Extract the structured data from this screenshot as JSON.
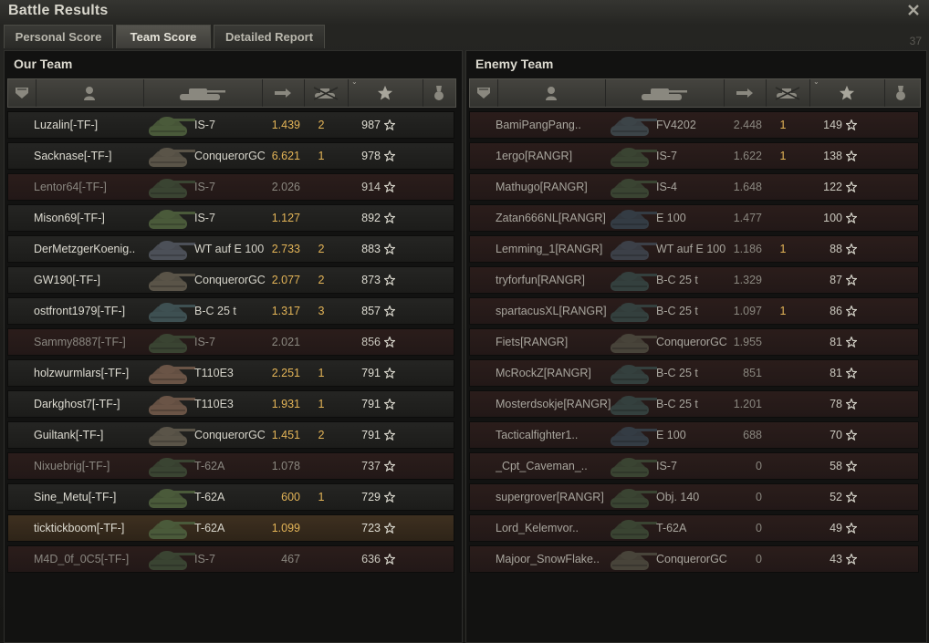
{
  "window": {
    "title": "Battle Results",
    "tab_counter": "37"
  },
  "tabs": [
    {
      "label": "Personal Score"
    },
    {
      "label": "Team Score"
    },
    {
      "label": "Detailed Report"
    }
  ],
  "active_tab": 1,
  "columns": [
    "rank-icon",
    "player-icon",
    "tank-icon",
    "damage-icon",
    "kills-icon",
    "xp-star-icon",
    "medal-icon"
  ],
  "sorted_column": "xp",
  "our_team": {
    "title": "Our Team",
    "rows": [
      {
        "player": "Luzalin[-TF-]",
        "tank": "IS-7",
        "damage": "1.439",
        "kills": "2",
        "xp": "987",
        "state": "alive",
        "tank_color": "#4a5a3a"
      },
      {
        "player": "Sacknase[-TF-]",
        "tank": "ConquerorGC",
        "damage": "6.621",
        "kills": "1",
        "xp": "978",
        "state": "alive",
        "tank_color": "#5a5448"
      },
      {
        "player": "Lentor64[-TF-]",
        "tank": "IS-7",
        "damage": "2.026",
        "kills": "",
        "xp": "914",
        "state": "dead",
        "tank_color": "#3a4432"
      },
      {
        "player": "Mison69[-TF-]",
        "tank": "IS-7",
        "damage": "1.127",
        "kills": "",
        "xp": "892",
        "state": "alive",
        "tank_color": "#4a5a3a"
      },
      {
        "player": "DerMetzgerKoenig..",
        "tank": "WT auf E 100",
        "damage": "2.733",
        "kills": "2",
        "xp": "883",
        "state": "alive",
        "tank_color": "#4c5058"
      },
      {
        "player": "GW190[-TF-]",
        "tank": "ConquerorGC",
        "damage": "2.077",
        "kills": "2",
        "xp": "873",
        "state": "alive",
        "tank_color": "#5a5448"
      },
      {
        "player": "ostfront1979[-TF-]",
        "tank": "B-C 25 t",
        "damage": "1.317",
        "kills": "3",
        "xp": "857",
        "state": "alive",
        "tank_color": "#3e5052"
      },
      {
        "player": "Sammy8887[-TF-]",
        "tank": "IS-7",
        "damage": "2.021",
        "kills": "",
        "xp": "856",
        "state": "dead",
        "tank_color": "#3a4432"
      },
      {
        "player": "holzwurmlars[-TF-]",
        "tank": "T110E3",
        "damage": "2.251",
        "kills": "1",
        "xp": "791",
        "state": "alive",
        "tank_color": "#6a5446"
      },
      {
        "player": "Darkghost7[-TF-]",
        "tank": "T110E3",
        "damage": "1.931",
        "kills": "1",
        "xp": "791",
        "state": "alive",
        "tank_color": "#6a5446"
      },
      {
        "player": "Guiltank[-TF-]",
        "tank": "ConquerorGC",
        "damage": "1.451",
        "kills": "2",
        "xp": "791",
        "state": "alive",
        "tank_color": "#5a5448"
      },
      {
        "player": "Nixuebrig[-TF-]",
        "tank": "T-62A",
        "damage": "1.078",
        "kills": "",
        "xp": "737",
        "state": "dead",
        "tank_color": "#3a4432"
      },
      {
        "player": "Sine_Metu[-TF-]",
        "tank": "T-62A",
        "damage": "600",
        "kills": "1",
        "xp": "729",
        "state": "alive",
        "tank_color": "#4a5a3a"
      },
      {
        "player": "ticktickboom[-TF-]",
        "tank": "T-62A",
        "damage": "1.099",
        "kills": "",
        "xp": "723",
        "state": "self",
        "tank_color": "#4a5a3a"
      },
      {
        "player": "M4D_0f_0C5[-TF-]",
        "tank": "IS-7",
        "damage": "467",
        "kills": "",
        "xp": "636",
        "state": "dead",
        "tank_color": "#3a4432"
      }
    ]
  },
  "enemy_team": {
    "title": "Enemy Team",
    "rows": [
      {
        "player": "BamiPangPang..",
        "tank": "FV4202",
        "damage": "2.448",
        "kills": "1",
        "xp": "149",
        "state": "dead",
        "tank_color": "#3c4448"
      },
      {
        "player": "1ergo[RANGR]",
        "tank": "IS-7",
        "damage": "1.622",
        "kills": "1",
        "xp": "138",
        "state": "dead",
        "tank_color": "#3a4432"
      },
      {
        "player": "Mathugo[RANGR]",
        "tank": "IS-4",
        "damage": "1.648",
        "kills": "",
        "xp": "122",
        "state": "dead",
        "tank_color": "#3a4432"
      },
      {
        "player": "Zatan666NL[RANGR]",
        "tank": "E 100",
        "damage": "1.477",
        "kills": "",
        "xp": "100",
        "state": "dead",
        "tank_color": "#343c44"
      },
      {
        "player": "Lemming_1[RANGR]",
        "tank": "WT auf E 100",
        "damage": "1.186",
        "kills": "1",
        "xp": "88",
        "state": "dead",
        "tank_color": "#3c4048"
      },
      {
        "player": "tryforfun[RANGR]",
        "tank": "B-C 25 t",
        "damage": "1.329",
        "kills": "",
        "xp": "87",
        "state": "dead",
        "tank_color": "#34403e"
      },
      {
        "player": "spartacusXL[RANGR]",
        "tank": "B-C 25 t",
        "damage": "1.097",
        "kills": "1",
        "xp": "86",
        "state": "dead",
        "tank_color": "#34403e"
      },
      {
        "player": "Fiets[RANGR]",
        "tank": "ConquerorGC",
        "damage": "1.955",
        "kills": "",
        "xp": "81",
        "state": "dead",
        "tank_color": "#48443a"
      },
      {
        "player": "McRockZ[RANGR]",
        "tank": "B-C 25 t",
        "damage": "851",
        "kills": "",
        "xp": "81",
        "state": "dead",
        "tank_color": "#34403e"
      },
      {
        "player": "Mosterdsokje[RANGR]",
        "tank": "B-C 25 t",
        "damage": "1.201",
        "kills": "",
        "xp": "78",
        "state": "dead",
        "tank_color": "#34403e"
      },
      {
        "player": "Tacticalfighter1..",
        "tank": "E 100",
        "damage": "688",
        "kills": "",
        "xp": "70",
        "state": "dead",
        "tank_color": "#343c44"
      },
      {
        "player": "_Cpt_Caveman_..",
        "tank": "IS-7",
        "damage": "0",
        "kills": "",
        "xp": "58",
        "state": "dead",
        "tank_color": "#3a4432"
      },
      {
        "player": "supergrover[RANGR]",
        "tank": "Obj. 140",
        "damage": "0",
        "kills": "",
        "xp": "52",
        "state": "dead",
        "tank_color": "#3a4432"
      },
      {
        "player": "Lord_Kelemvor..",
        "tank": "T-62A",
        "damage": "0",
        "kills": "",
        "xp": "49",
        "state": "dead",
        "tank_color": "#3a4432"
      },
      {
        "player": "Majoor_SnowFlake..",
        "tank": "ConquerorGC",
        "damage": "0",
        "kills": "",
        "xp": "43",
        "state": "dead",
        "tank_color": "#48443a"
      }
    ]
  }
}
